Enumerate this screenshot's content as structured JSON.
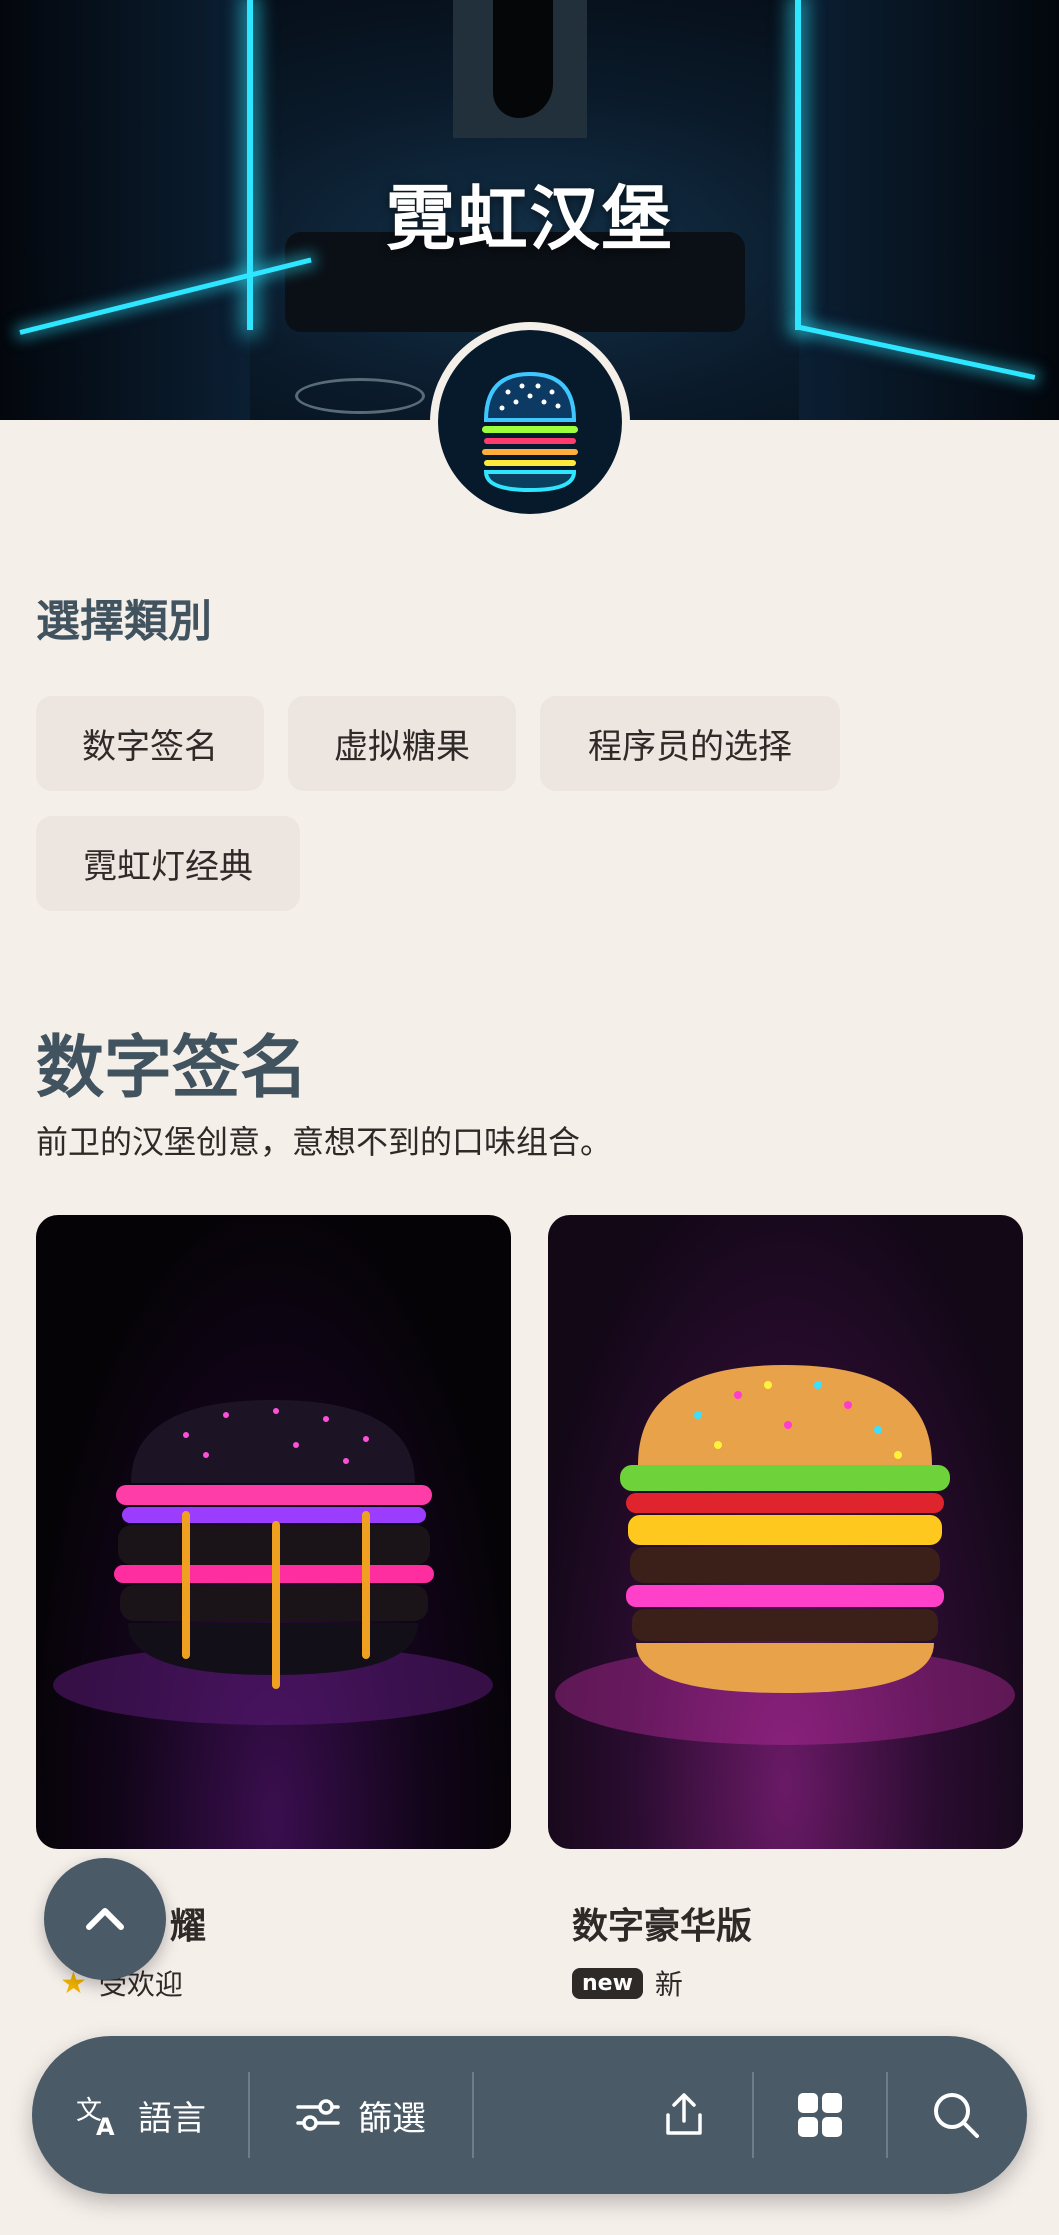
{
  "hero": {
    "title": "霓虹汉堡"
  },
  "categories": {
    "heading": "選擇類別",
    "chips": [
      "数字签名",
      "虚拟糖果",
      "程序员的选择",
      "霓虹灯经典"
    ]
  },
  "section": {
    "title": "数字签名",
    "description": "前卫的汉堡创意，意想不到的口味组合。"
  },
  "cards": [
    {
      "title": "耀",
      "badge_icon": "star-icon",
      "badge_text": "受欢迎"
    },
    {
      "title": "数字豪华版",
      "badge_icon": "new",
      "badge_text": "新"
    }
  ],
  "bottom_bar": {
    "language_label": "語言",
    "filter_label": "篩選"
  },
  "colors": {
    "bar": "#4a5a66",
    "heading": "#41535f",
    "background": "#f5efea",
    "neon": "#2ee6ff"
  }
}
